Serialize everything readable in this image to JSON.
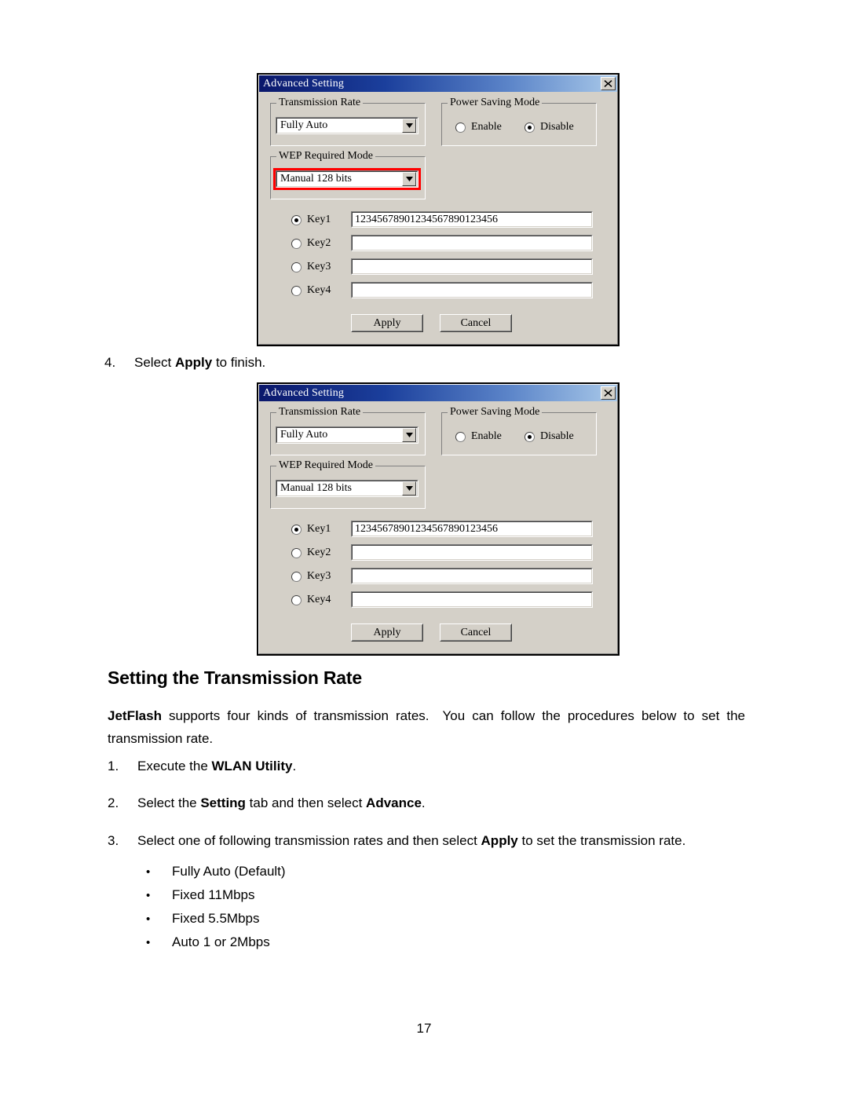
{
  "page": {
    "number": "17"
  },
  "dialog": {
    "title": "Advanced Setting",
    "close_icon": "close-icon",
    "transmission_rate": {
      "legend": "Transmission Rate",
      "value": "Fully Auto"
    },
    "wep_required_mode": {
      "legend": "WEP Required Mode",
      "value": "Manual 128 bits"
    },
    "power_saving_mode": {
      "legend": "Power Saving Mode",
      "options": [
        {
          "label": "Enable",
          "checked": false
        },
        {
          "label": "Disable",
          "checked": true
        }
      ]
    },
    "keys": [
      {
        "label": "Key1",
        "checked": true,
        "value": "12345678901234567890123456"
      },
      {
        "label": "Key2",
        "checked": false,
        "value": ""
      },
      {
        "label": "Key3",
        "checked": false,
        "value": ""
      },
      {
        "label": "Key4",
        "checked": false,
        "value": ""
      }
    ],
    "buttons": {
      "apply": "Apply",
      "cancel": "Cancel"
    },
    "highlight_color": "#ff0000",
    "titlebar_gradient_start": "#0a176b",
    "titlebar_gradient_end": "#a9c9e9",
    "face_color": "#d4d0c8"
  },
  "content": {
    "step4": {
      "number": "4.",
      "text_before": "Select ",
      "bold": "Apply",
      "text_after": " to finish."
    },
    "section_title": "Setting the Transmission Rate",
    "intro": {
      "bold": "JetFlash",
      "text": " supports four kinds of transmission rates. You can follow the procedures below to set the transmission rate."
    },
    "steps": [
      {
        "number": "1.",
        "parts": [
          {
            "text": "Execute the ",
            "bold": false
          },
          {
            "text": "WLAN Utility",
            "bold": true
          },
          {
            "text": ".",
            "bold": false
          }
        ]
      },
      {
        "number": "2.",
        "parts": [
          {
            "text": "Select the ",
            "bold": false
          },
          {
            "text": "Setting",
            "bold": true
          },
          {
            "text": " tab and then select ",
            "bold": false
          },
          {
            "text": "Advance",
            "bold": true
          },
          {
            "text": ".",
            "bold": false
          }
        ]
      },
      {
        "number": "3.",
        "parts": [
          {
            "text": "Select one of following transmission rates and then select ",
            "bold": false
          },
          {
            "text": "Apply",
            "bold": true
          },
          {
            "text": " to set the transmission rate.",
            "bold": false
          }
        ]
      }
    ],
    "rates": [
      {
        "bullet": "•",
        "label": "Fully Auto (Default)"
      },
      {
        "bullet": "•",
        "label": "Fixed 11Mbps"
      },
      {
        "bullet": "•",
        "label": "Fixed 5.5Mbps"
      },
      {
        "bullet": "•",
        "label": "Auto 1 or 2Mbps"
      }
    ]
  }
}
